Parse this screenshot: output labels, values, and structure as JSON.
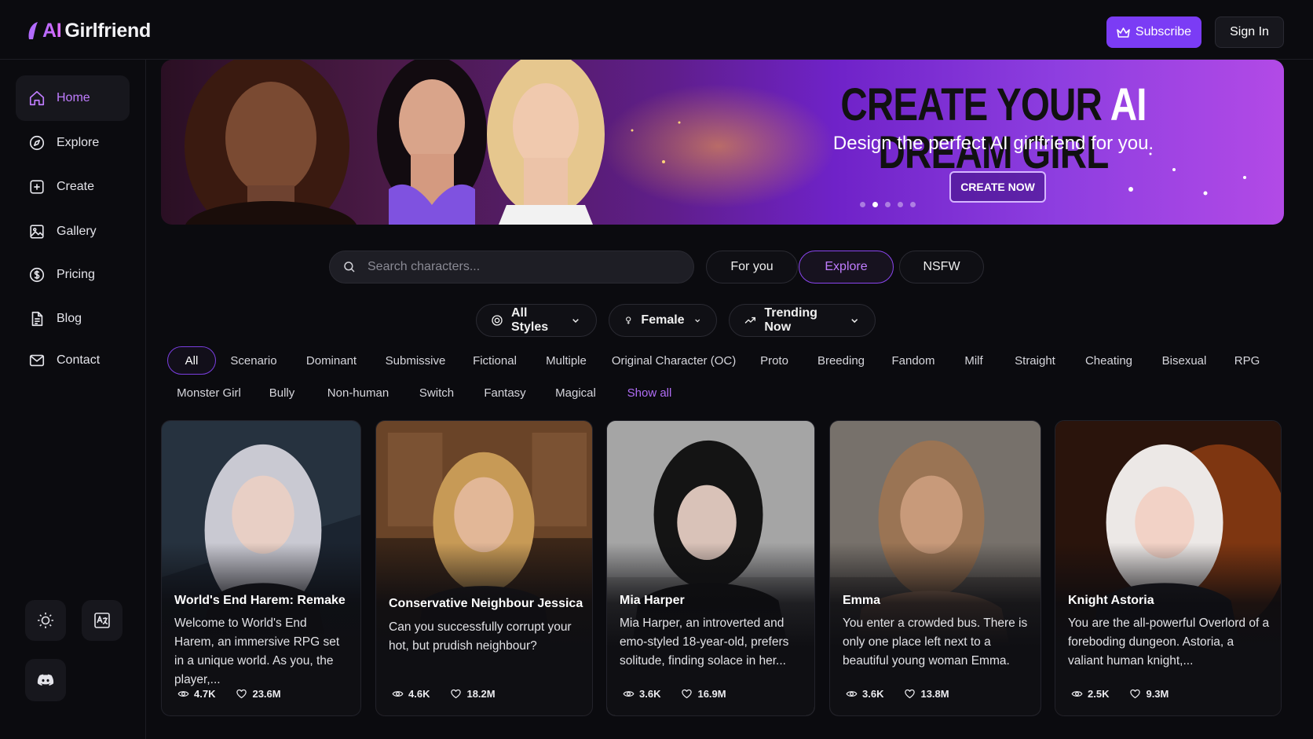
{
  "brand": {
    "ai": "AI",
    "rest": "Girlfriend"
  },
  "header": {
    "subscribe_label": "Subscribe",
    "signin_label": "Sign In"
  },
  "sidebar": {
    "items": [
      {
        "label": "Home",
        "icon": "home-icon",
        "active": true
      },
      {
        "label": "Explore",
        "icon": "compass-icon"
      },
      {
        "label": "Create",
        "icon": "plus-square-icon"
      },
      {
        "label": "Gallery",
        "icon": "image-icon"
      },
      {
        "label": "Pricing",
        "icon": "dollar-circle-icon"
      },
      {
        "label": "Blog",
        "icon": "document-icon"
      },
      {
        "label": "Contact",
        "icon": "mail-icon"
      }
    ]
  },
  "banner": {
    "headline_part1": "CREATE YOUR",
    "headline_ai": "AI",
    "headline_part2": "DREAM GIRL",
    "subhead": "Design the perfect AI girlfriend for you.",
    "cta_label": "CREATE NOW",
    "slides": 5,
    "active_slide": 2
  },
  "search": {
    "placeholder": "Search characters..."
  },
  "tabs": [
    {
      "label": "For you"
    },
    {
      "label": "Explore",
      "active": true
    },
    {
      "label": "NSFW"
    }
  ],
  "filters": {
    "style": "All Styles",
    "gender": "Female",
    "sort": "Trending Now"
  },
  "tags_row1": [
    "All",
    "Scenario",
    "Dominant",
    "Submissive",
    "Fictional",
    "Multiple",
    "Original Character (OC)",
    "Proto",
    "Breeding",
    "Fandom",
    "Milf",
    "Straight",
    "Cheating",
    "Bisexual",
    "RPG"
  ],
  "tags_row2": [
    "Monster Girl",
    "Bully",
    "Non-human",
    "Switch",
    "Fantasy",
    "Magical"
  ],
  "show_all_label": "Show all",
  "cards": [
    {
      "title": "World's End Harem: Remake",
      "desc": "Welcome to World's End Harem, an immersive RPG set in a unique world. As you, the player,...",
      "views": "4.7K",
      "likes": "23.6M"
    },
    {
      "title": "Conservative Neighbour Jessica",
      "desc": "Can you successfully corrupt your hot, but prudish neighbour?",
      "views": "4.6K",
      "likes": "18.2M"
    },
    {
      "title": "Mia Harper",
      "desc": "Mia Harper, an introverted and emo-styled 18-year-old, prefers solitude, finding solace in her...",
      "views": "3.6K",
      "likes": "16.9M"
    },
    {
      "title": "Emma",
      "desc": "You enter a crowded bus. There is only one place left next to a beautiful young woman Emma.",
      "views": "3.6K",
      "likes": "13.8M"
    },
    {
      "title": "Knight Astoria",
      "desc": "You are the all-powerful Overlord of a foreboding dungeon. Astoria, a valiant human knight,...",
      "views": "2.5K",
      "likes": "9.3M"
    }
  ],
  "colors": {
    "accent": "#7b3cf5",
    "accent_text": "#c07dff",
    "background": "#0b0b0f"
  }
}
